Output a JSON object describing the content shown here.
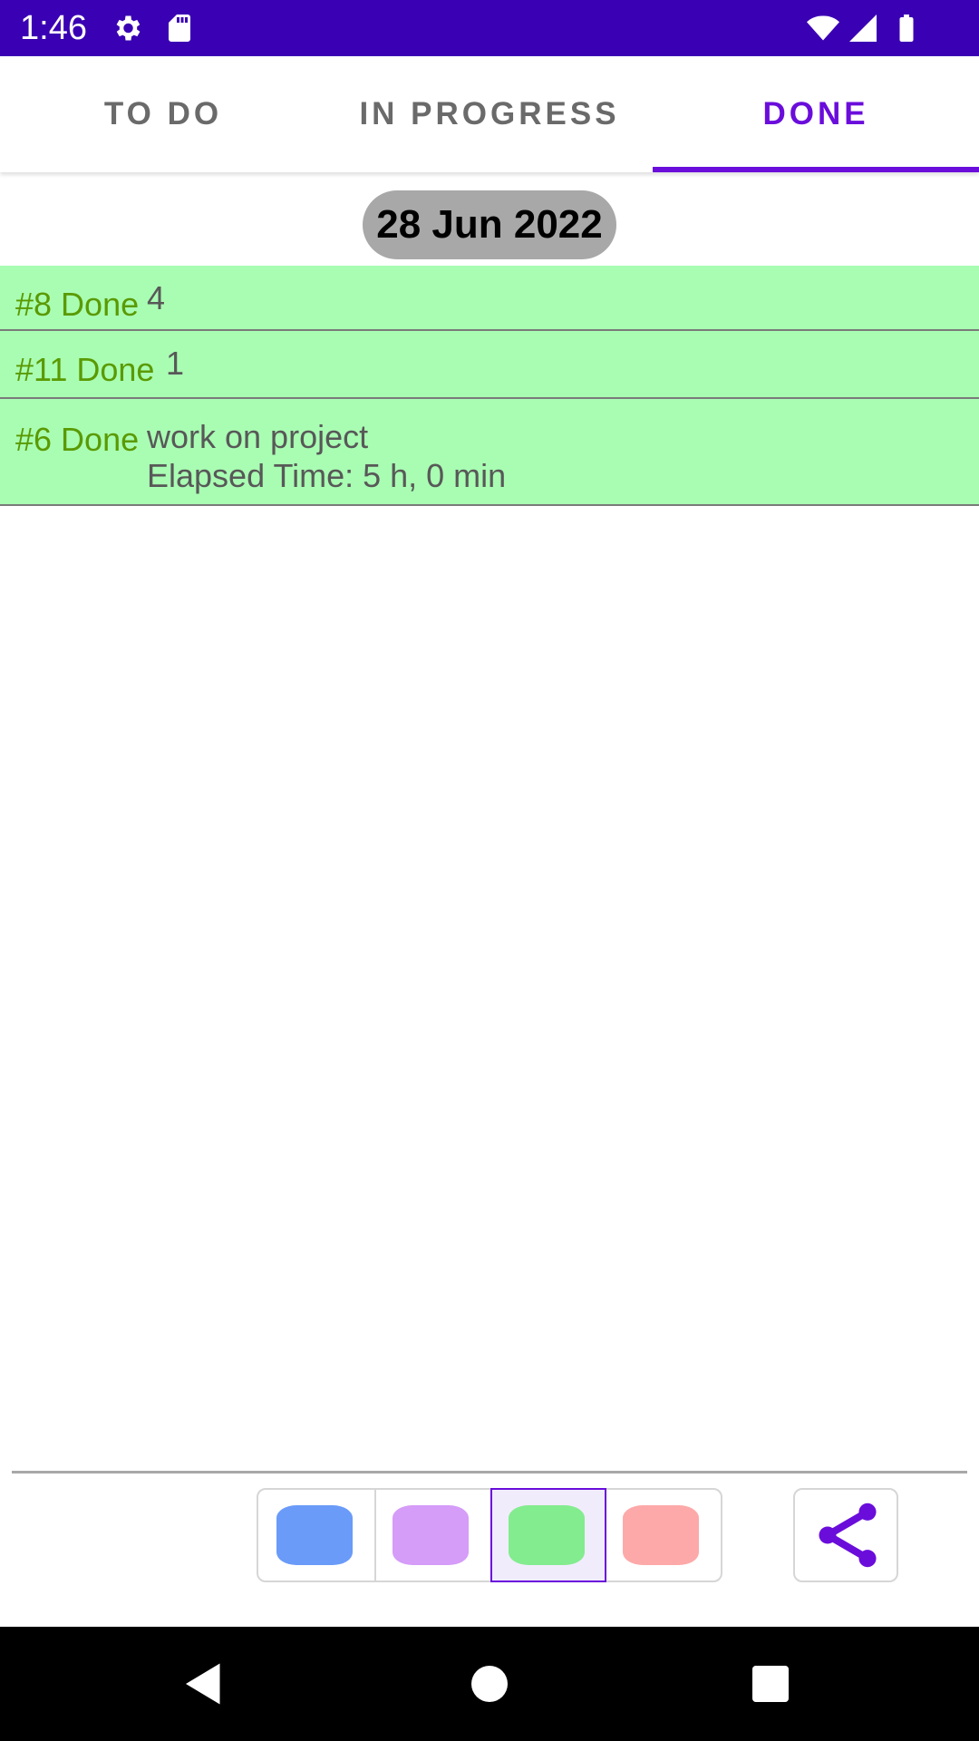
{
  "status_bar": {
    "time": "1:46",
    "left_icons": [
      "gear-icon",
      "sd-card-icon"
    ],
    "right_icons": [
      "wifi-icon",
      "cell-signal-icon",
      "battery-icon"
    ],
    "background": "#3a00b3"
  },
  "tabs": [
    {
      "label": "TO DO",
      "active": false
    },
    {
      "label": "IN PROGRESS",
      "active": false
    },
    {
      "label": "DONE",
      "active": true
    }
  ],
  "accent_color": "#6a0ddb",
  "date_header": "28 Jun 2022",
  "tasks": [
    {
      "id_status": "#8 Done",
      "text": "4",
      "detail": ""
    },
    {
      "id_status": "#11 Done",
      "text": "1",
      "detail": ""
    },
    {
      "id_status": "#6 Done",
      "text": "work on project",
      "detail": "Elapsed Time: 5 h, 0 min"
    }
  ],
  "row_color": "#a9fdb3",
  "color_options": [
    {
      "name": "blue",
      "hex": "#6a9bf8",
      "selected": false
    },
    {
      "name": "purple",
      "hex": "#d59cf8",
      "selected": false
    },
    {
      "name": "green",
      "hex": "#83ec8f",
      "selected": true
    },
    {
      "name": "red",
      "hex": "#fda9a9",
      "selected": false
    }
  ],
  "share_icon": "share-icon",
  "nav_bar": {
    "buttons": [
      "back-icon",
      "home-icon",
      "recents-icon"
    ]
  }
}
